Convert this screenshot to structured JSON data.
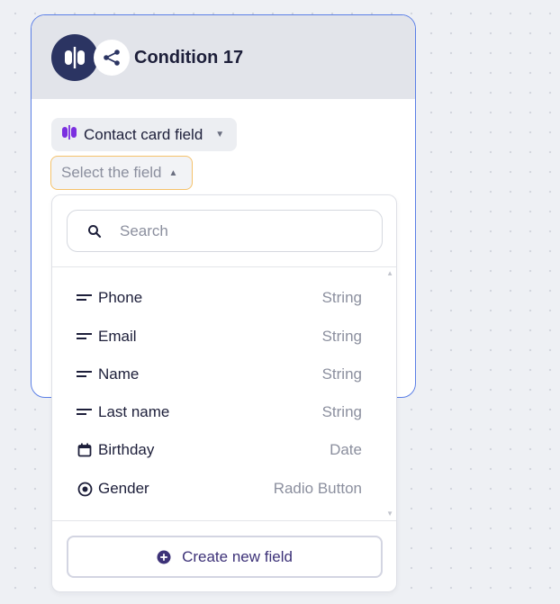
{
  "node": {
    "title": "Condition 17",
    "icon": "split-icon",
    "share_icon": "share-icon",
    "accent": "#5b7fe6",
    "icon_bg": "#2b3462"
  },
  "condition": {
    "source_label": "Contact card field",
    "source_icon": "contact-card-icon",
    "select_placeholder": "Select the field"
  },
  "dropdown": {
    "search_placeholder": "Search",
    "items": [
      {
        "name": "Phone",
        "type": "String",
        "icon": "text-field-icon"
      },
      {
        "name": "Email",
        "type": "String",
        "icon": "text-field-icon"
      },
      {
        "name": "Name",
        "type": "String",
        "icon": "text-field-icon"
      },
      {
        "name": "Last name",
        "type": "String",
        "icon": "text-field-icon"
      },
      {
        "name": "Birthday",
        "type": "Date",
        "icon": "calendar-icon"
      },
      {
        "name": "Gender",
        "type": "Radio Button",
        "icon": "radio-icon"
      }
    ],
    "create_label": "Create new field",
    "create_icon": "plus-circle-icon",
    "brand_color": "#3d3278"
  }
}
